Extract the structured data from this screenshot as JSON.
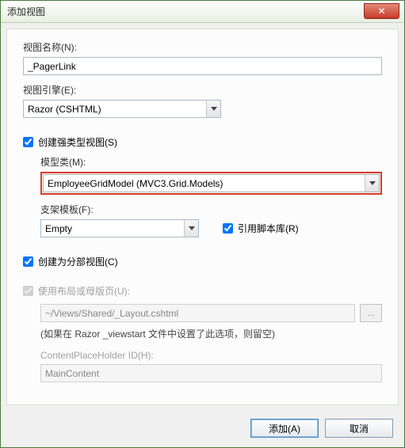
{
  "titlebar": {
    "title": "添加视图"
  },
  "labels": {
    "view_name": "视图名称(N):",
    "view_engine": "视图引擎(E):",
    "strongly_typed": "创建强类型视图(S)",
    "model_class": "模型类(M):",
    "scaffold_template": "支架模板(F):",
    "reference_scripts": "引用脚本库(R)",
    "partial_view": "创建为分部视图(C)",
    "use_layout": "使用布局或母版页(U):",
    "layout_hint": "(如果在 Razor _viewstart 文件中设置了此选项，则留空)",
    "placeholder_id": "ContentPlaceHolder ID(H):"
  },
  "values": {
    "view_name": "_PagerLink",
    "view_engine": "Razor (CSHTML)",
    "model_class": "EmployeeGridModel (MVC3.Grid.Models)",
    "scaffold_template": "Empty",
    "layout_path": "~/Views/Shared/_Layout.cshtml",
    "placeholder_id": "MainContent"
  },
  "buttons": {
    "browse": "...",
    "add": "添加(A)",
    "cancel": "取消"
  },
  "icons": {
    "close": "✕"
  }
}
